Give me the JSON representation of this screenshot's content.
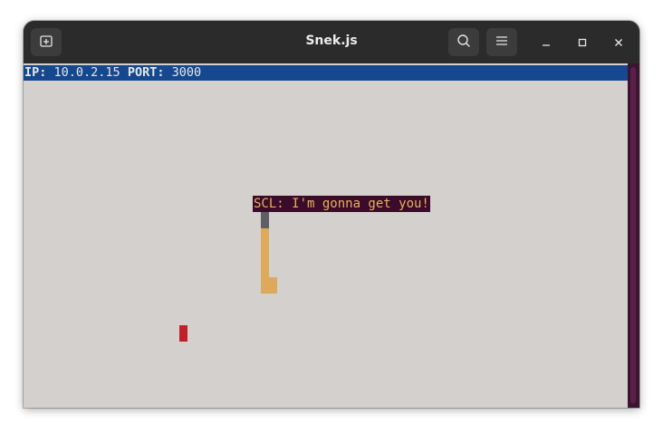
{
  "window": {
    "title": "Snek.js"
  },
  "icons": {
    "new_tab": "new-tab-icon",
    "search": "search-icon",
    "menu": "hamburger-menu-icon",
    "minimize": "minimize-icon",
    "maximize": "maximize-icon",
    "close": "close-icon"
  },
  "status": {
    "ip_label": "IP:",
    "ip_value": "10.0.2.15",
    "port_label": "PORT:",
    "port_value": "3000"
  },
  "game": {
    "speech_text": "SCL: I'm gonna get you!",
    "colors": {
      "background": "#d3d0ce",
      "status_bar": "#16488f",
      "speech_bg": "#3b0b2a",
      "speech_text": "#e6b35a",
      "snake_head": "#5f5d65",
      "snake_body": "#dcaa5a",
      "food": "#c0202a"
    }
  }
}
